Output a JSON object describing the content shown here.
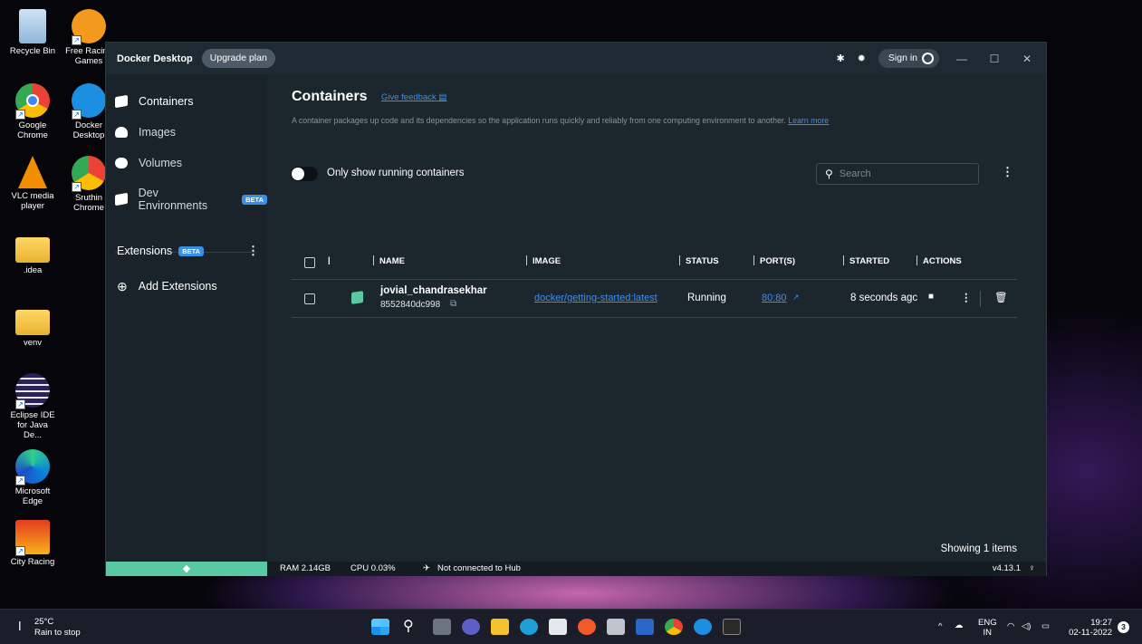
{
  "desktop": {
    "icons": [
      {
        "label": "Recycle Bin"
      },
      {
        "label": "Free Racing Games"
      },
      {
        "label": "Google Chrome"
      },
      {
        "label": "Docker Desktop"
      },
      {
        "label": "VLC media player"
      },
      {
        "label": "Sruthin Chrome"
      },
      {
        "label": ".idea"
      },
      {
        "label": "venv"
      },
      {
        "label": "Eclipse IDE for Java De..."
      },
      {
        "label": "Microsoft Edge"
      },
      {
        "label": "City Racing"
      }
    ]
  },
  "window": {
    "app_name": "Docker Desktop",
    "upgrade_label": "Upgrade plan",
    "signin_label": "Sign in",
    "minimize": "—",
    "maximize": "☐",
    "close": "✕"
  },
  "sidebar": {
    "items": [
      {
        "label": "Containers"
      },
      {
        "label": "Images"
      },
      {
        "label": "Volumes"
      },
      {
        "label": "Dev Environments",
        "badge": "BETA"
      }
    ],
    "extensions_label": "Extensions",
    "extensions_badge": "BETA",
    "add_extensions_label": "Add Extensions"
  },
  "main": {
    "title": "Containers",
    "feedback_label": "Give feedback",
    "description": "A container packages up code and its dependencies so the application runs quickly and reliably from one computing environment to another.",
    "learn_more": "Learn more",
    "toggle_label": "Only show running containers",
    "search_placeholder": "Search",
    "columns": [
      "NAME",
      "IMAGE",
      "STATUS",
      "PORT(S)",
      "STARTED",
      "ACTIONS"
    ],
    "rows": [
      {
        "name": "jovial_chandrasekhar",
        "id": "8552840dc998",
        "image": "docker/getting-started:latest",
        "status": "Running",
        "ports": "80:80",
        "started": "8 seconds agc"
      }
    ],
    "showing": "Showing 1 items"
  },
  "statusbar": {
    "ram": "RAM 2.14GB",
    "cpu": "CPU 0.03%",
    "hub": "Not connected to Hub",
    "version": "v4.13.1"
  },
  "taskbar": {
    "temperature": "25°C",
    "weather": "Rain to stop",
    "language_top": "ENG",
    "language_bottom": "IN",
    "time": "19:27",
    "date": "02-11-2022",
    "notifications": "3"
  },
  "colors": {
    "accent": "#3e8ff0",
    "docker_green": "#58c9a2",
    "window_bg": "#1c262d"
  }
}
